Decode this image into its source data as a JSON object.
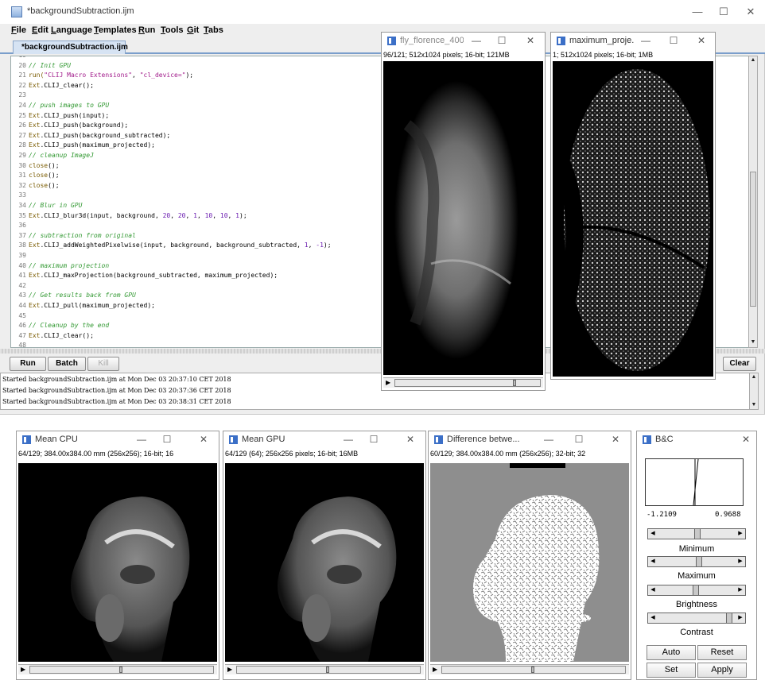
{
  "editor": {
    "title": "*backgroundSubtraction.ijm",
    "menu": [
      "File",
      "Edit",
      "Language",
      "Templates",
      "Run",
      "Tools",
      "Git",
      "Tabs"
    ],
    "tab": "*backgroundSubtraction.ijm",
    "code": [
      {
        "n": "19",
        "parts": []
      },
      {
        "n": "20",
        "parts": [
          {
            "c": "cm",
            "t": "// Init GPU"
          }
        ]
      },
      {
        "n": "21",
        "parts": [
          {
            "c": "fn",
            "t": "run("
          },
          {
            "c": "st",
            "t": "\"CLIJ Macro Extensions\""
          },
          {
            "c": "",
            "t": ", "
          },
          {
            "c": "st",
            "t": "\"cl_device=\""
          },
          {
            "c": "",
            "t": ");"
          }
        ]
      },
      {
        "n": "22",
        "parts": [
          {
            "c": "fn",
            "t": "Ext"
          },
          {
            "c": "",
            "t": ".CLIJ_clear();"
          }
        ]
      },
      {
        "n": "23",
        "parts": []
      },
      {
        "n": "24",
        "parts": [
          {
            "c": "cm",
            "t": "// push images to GPU"
          }
        ]
      },
      {
        "n": "25",
        "parts": [
          {
            "c": "fn",
            "t": "Ext"
          },
          {
            "c": "",
            "t": ".CLIJ_push(input);"
          }
        ]
      },
      {
        "n": "26",
        "parts": [
          {
            "c": "fn",
            "t": "Ext"
          },
          {
            "c": "",
            "t": ".CLIJ_push(background);"
          }
        ]
      },
      {
        "n": "27",
        "parts": [
          {
            "c": "fn",
            "t": "Ext"
          },
          {
            "c": "",
            "t": ".CLIJ_push(background_subtracted);"
          }
        ]
      },
      {
        "n": "28",
        "parts": [
          {
            "c": "fn",
            "t": "Ext"
          },
          {
            "c": "",
            "t": ".CLIJ_push(maximum_projected);"
          }
        ]
      },
      {
        "n": "29",
        "parts": [
          {
            "c": "cm",
            "t": "// cleanup ImageJ"
          }
        ]
      },
      {
        "n": "30",
        "parts": [
          {
            "c": "fn",
            "t": "close"
          },
          {
            "c": "",
            "t": "();"
          }
        ]
      },
      {
        "n": "31",
        "parts": [
          {
            "c": "fn",
            "t": "close"
          },
          {
            "c": "",
            "t": "();"
          }
        ]
      },
      {
        "n": "32",
        "parts": [
          {
            "c": "fn",
            "t": "close"
          },
          {
            "c": "",
            "t": "();"
          }
        ]
      },
      {
        "n": "33",
        "parts": []
      },
      {
        "n": "34",
        "parts": [
          {
            "c": "cm",
            "t": "// Blur in GPU"
          }
        ]
      },
      {
        "n": "35",
        "parts": [
          {
            "c": "fn",
            "t": "Ext"
          },
          {
            "c": "",
            "t": ".CLIJ_blur3d(input, background, "
          },
          {
            "c": "nm",
            "t": "20"
          },
          {
            "c": "",
            "t": ", "
          },
          {
            "c": "nm",
            "t": "20"
          },
          {
            "c": "",
            "t": ", "
          },
          {
            "c": "nm",
            "t": "1"
          },
          {
            "c": "",
            "t": ", "
          },
          {
            "c": "nm",
            "t": "10"
          },
          {
            "c": "",
            "t": ", "
          },
          {
            "c": "nm",
            "t": "10"
          },
          {
            "c": "",
            "t": ", "
          },
          {
            "c": "nm",
            "t": "1"
          },
          {
            "c": "",
            "t": ");"
          }
        ]
      },
      {
        "n": "36",
        "parts": []
      },
      {
        "n": "37",
        "parts": [
          {
            "c": "cm",
            "t": "// subtraction from original"
          }
        ]
      },
      {
        "n": "38",
        "parts": [
          {
            "c": "fn",
            "t": "Ext"
          },
          {
            "c": "",
            "t": ".CLIJ_addWeightedPixelwise(input, background, background_subtracted, "
          },
          {
            "c": "nm",
            "t": "1"
          },
          {
            "c": "",
            "t": ", "
          },
          {
            "c": "nm",
            "t": "-1"
          },
          {
            "c": "",
            "t": ");"
          }
        ]
      },
      {
        "n": "39",
        "parts": []
      },
      {
        "n": "40",
        "parts": [
          {
            "c": "cm",
            "t": "// maximum projection"
          }
        ]
      },
      {
        "n": "41",
        "parts": [
          {
            "c": "fn",
            "t": "Ext"
          },
          {
            "c": "",
            "t": ".CLIJ_maxProjection(background_subtracted, maximum_projected);"
          }
        ]
      },
      {
        "n": "42",
        "parts": []
      },
      {
        "n": "43",
        "parts": [
          {
            "c": "cm",
            "t": "// Get results back from GPU"
          }
        ]
      },
      {
        "n": "44",
        "parts": [
          {
            "c": "fn",
            "t": "Ext"
          },
          {
            "c": "",
            "t": ".CLIJ_pull(maximum_projected);"
          }
        ]
      },
      {
        "n": "45",
        "parts": []
      },
      {
        "n": "46",
        "parts": [
          {
            "c": "cm",
            "t": "// Cleanup by the end"
          }
        ]
      },
      {
        "n": "47",
        "parts": [
          {
            "c": "fn",
            "t": "Ext"
          },
          {
            "c": "",
            "t": ".CLIJ_clear();"
          }
        ]
      },
      {
        "n": "48",
        "parts": []
      }
    ],
    "buttons": {
      "run": "Run",
      "batch": "Batch",
      "kill": "Kill",
      "clear": "Clear"
    },
    "output": [
      "Started backgroundSubtraction.ijm at Mon Dec 03 20:37:10 CET 2018",
      "Started backgroundSubtraction.ijm at Mon Dec 03 20:37:36 CET 2018",
      "Started backgroundSubtraction.ijm at Mon Dec 03 20:38:31 CET 2018"
    ]
  },
  "windows": {
    "fly": {
      "title": "fly_florence_400....",
      "info": "96/121; 512x1024 pixels; 16-bit; 121MB"
    },
    "maxproj": {
      "title": "maximum_proje...",
      "info": "1; 512x1024 pixels; 16-bit; 1MB"
    },
    "meancpu": {
      "title": "Mean CPU",
      "info": "64/129; 384.00x384.00 mm (256x256); 16-bit; 16"
    },
    "meangpu": {
      "title": "Mean GPU",
      "info": "64/129 (64); 256x256 pixels; 16-bit; 16MB"
    },
    "diff": {
      "title": "Difference betwe...",
      "info": "60/129; 384.00x384.00 mm (256x256); 32-bit; 32"
    }
  },
  "bc": {
    "title": "B&C",
    "min_value": "-1.2109",
    "max_value": "0.9688",
    "labels": [
      "Minimum",
      "Maximum",
      "Brightness",
      "Contrast"
    ],
    "buttons": {
      "auto": "Auto",
      "reset": "Reset",
      "set": "Set",
      "apply": "Apply"
    }
  },
  "icons": {
    "minimize": "—",
    "maximize": "☐",
    "close": "✕",
    "play": "▶",
    "left": "◀",
    "right": "▶",
    "up": "▲",
    "down": "▼"
  }
}
